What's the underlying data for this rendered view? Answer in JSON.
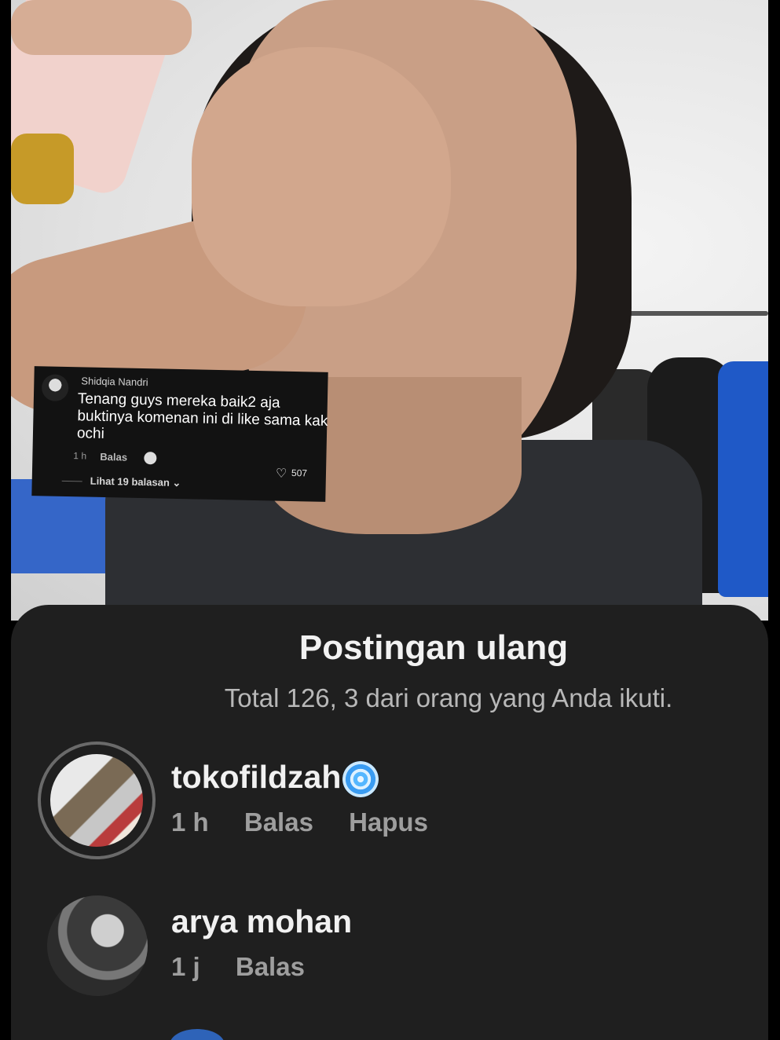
{
  "comment_card": {
    "username": "Shidqia Nandri",
    "text": "Tenang guys mereka baik2 aja buktinya komenan ini di like sama kak ochi",
    "time": "1 h",
    "reply_label": "Balas",
    "likes": "507",
    "view_replies": "Lihat 19 balasan"
  },
  "sheet": {
    "title": "Postingan ulang",
    "subtitle": "Total 126, 3 dari orang yang Anda ikuti.",
    "items": [
      {
        "name": "tokofildzah",
        "time": "1 h",
        "reply": "Balas",
        "delete": "Hapus",
        "verified_icon": "swirl-badge-icon"
      },
      {
        "name": "arya mohan",
        "time": "1 j",
        "reply": "Balas"
      }
    ]
  },
  "colors": {
    "sheet_bg": "#1f1f1f",
    "title": "#f2f2f2",
    "muted": "#9e9e9e"
  }
}
